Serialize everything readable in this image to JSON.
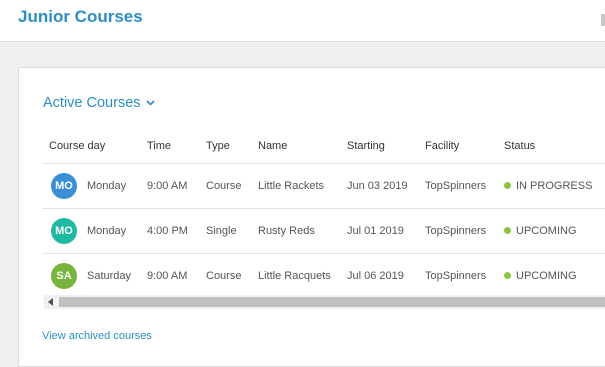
{
  "header": {
    "title": "Junior Courses"
  },
  "section": {
    "title": "Active Courses"
  },
  "table": {
    "columns": [
      "Course day",
      "Time",
      "Type",
      "Name",
      "Starting",
      "Facility",
      "Status"
    ],
    "rows": [
      {
        "initials": "MO",
        "avatar_color": "#3a8fd6",
        "day": "Monday",
        "time": "9:00 AM",
        "type": "Course",
        "name": "Little Rackets",
        "starting": "Jun 03 2019",
        "facility": "TopSpinners",
        "status": "IN PROGRESS"
      },
      {
        "initials": "MO",
        "avatar_color": "#1fb8a0",
        "day": "Monday",
        "time": "4:00 PM",
        "type": "Single",
        "name": "Rusty Reds",
        "starting": "Jul 01 2019",
        "facility": "TopSpinners",
        "status": "UPCOMING"
      },
      {
        "initials": "SA",
        "avatar_color": "#7ab33e",
        "day": "Saturday",
        "time": "9:00 AM",
        "type": "Course",
        "name": "Little Racquets",
        "starting": "Jul 06 2019",
        "facility": "TopSpinners",
        "status": "UPCOMING"
      }
    ]
  },
  "footer": {
    "archived_link": "View archived courses"
  },
  "colors": {
    "accent": "#2c8fc4",
    "status_dot": "#8cc63f"
  }
}
